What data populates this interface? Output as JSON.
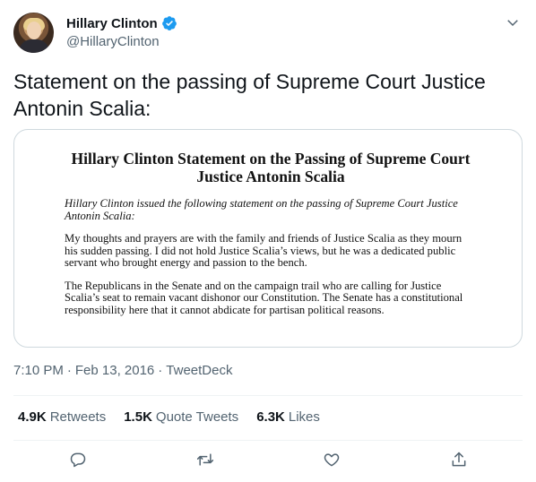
{
  "author": {
    "display_name": "Hillary Clinton",
    "handle": "@HillaryClinton",
    "verified": true
  },
  "tweet": {
    "text": "Statement on the passing of Supreme Court Justice Antonin Scalia:"
  },
  "document": {
    "title": "Hillary Clinton Statement on the Passing of Supreme Court Justice Antonin Scalia",
    "intro": "Hillary Clinton issued the following statement on the passing of Supreme Court Justice Antonin Scalia:",
    "paragraphs": [
      "My thoughts and prayers are with the family and friends of Justice Scalia as they mourn his sudden passing. I did not hold Justice Scalia’s views, but he was a dedicated public servant who brought energy and passion to the bench.",
      "The Republicans in the Senate and on the campaign trail who are calling for Justice Scalia’s seat to remain vacant dishonor our Constitution.  The Senate has a constitutional responsibility here that it cannot abdicate for partisan political reasons."
    ]
  },
  "meta": {
    "time": "7:10 PM",
    "separator": "·",
    "date": "Feb 13, 2016",
    "source": "TweetDeck"
  },
  "stats": {
    "retweets_count": "4.9K",
    "retweets_label": "Retweets",
    "quotes_count": "1.5K",
    "quotes_label": "Quote Tweets",
    "likes_count": "6.3K",
    "likes_label": "Likes"
  },
  "colors": {
    "verified_blue": "#1d9bf0",
    "icon_gray": "#536471",
    "border": "#cfd9de"
  },
  "icons": {
    "reply": "reply-icon",
    "retweet": "retweet-icon",
    "like": "like-icon",
    "share": "share-icon",
    "more": "chevron-down-icon",
    "verified": "verified-badge-icon"
  }
}
